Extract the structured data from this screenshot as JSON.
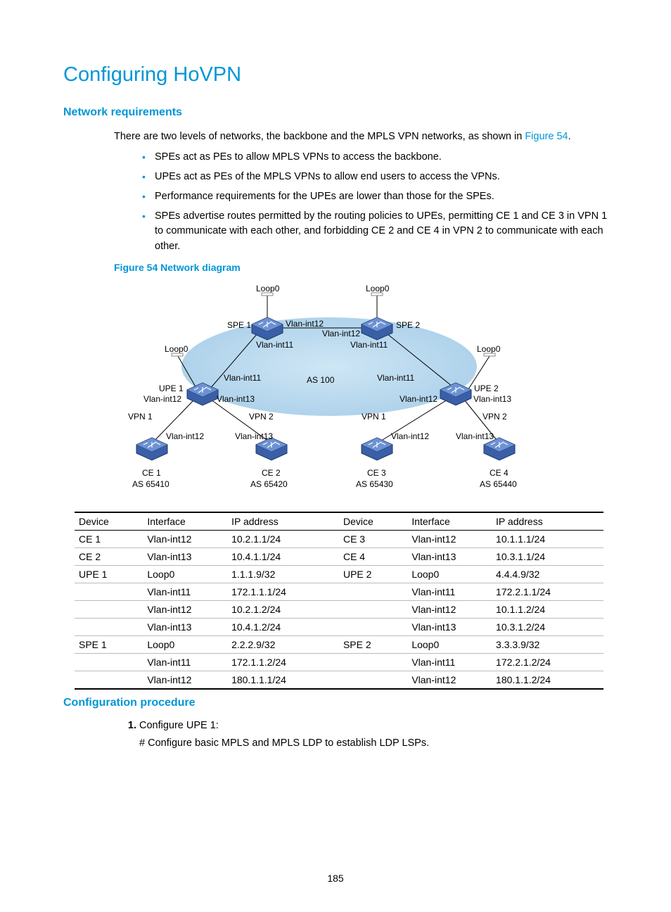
{
  "title": "Configuring HoVPN",
  "sections": {
    "network_req_heading": "Network requirements",
    "intro_pre": "There are two levels of networks, the backbone and the MPLS VPN networks, as shown in ",
    "intro_link": "Figure 54",
    "intro_post": ".",
    "bullets": [
      "SPEs act as PEs to allow MPLS VPNs to access the backbone.",
      "UPEs act as PEs of the MPLS VPNs to allow end users to access the VPNs.",
      "Performance requirements for the UPEs are lower than those for the SPEs.",
      "SPEs advertise routes permitted by the routing policies to UPEs, permitting CE 1 and CE 3 in VPN 1 to communicate with each other, and forbidding CE 2 and CE 4 in VPN 2 to communicate with each other."
    ],
    "figure_caption": "Figure 54 Network diagram",
    "config_proc_heading": "Configuration procedure",
    "step1_title": "Configure UPE 1:",
    "step1_line": "# Configure basic MPLS and MPLS LDP to establish LDP LSPs."
  },
  "diagram": {
    "as_cloud": "AS 100",
    "loop0": "Loop0",
    "spe1": "SPE 1",
    "spe2": "SPE 2",
    "upe1": "UPE 1",
    "upe2": "UPE 2",
    "vpn1": "VPN 1",
    "vpn2": "VPN 2",
    "vlan11": "Vlan-int11",
    "vlan12": "Vlan-int12",
    "vlan13": "Vlan-int13",
    "ce1": "CE 1",
    "ce2": "CE 2",
    "ce3": "CE 3",
    "ce4": "CE 4",
    "as65410": "AS 65410",
    "as65420": "AS 65420",
    "as65430": "AS 65430",
    "as65440": "AS 65440"
  },
  "table": {
    "headers": [
      "Device",
      "Interface",
      "IP address",
      "Device",
      "Interface",
      "IP address"
    ],
    "rows": [
      [
        "CE 1",
        "Vlan-int12",
        "10.2.1.1/24",
        "CE 3",
        "Vlan-int12",
        "10.1.1.1/24"
      ],
      [
        "CE 2",
        "Vlan-int13",
        "10.4.1.1/24",
        "CE 4",
        "Vlan-int13",
        "10.3.1.1/24"
      ],
      [
        "UPE 1",
        "Loop0",
        "1.1.1.9/32",
        "UPE 2",
        "Loop0",
        "4.4.4.9/32"
      ],
      [
        "",
        "Vlan-int11",
        "172.1.1.1/24",
        "",
        "Vlan-int11",
        "172.2.1.1/24"
      ],
      [
        "",
        "Vlan-int12",
        "10.2.1.2/24",
        "",
        "Vlan-int12",
        "10.1.1.2/24"
      ],
      [
        "",
        "Vlan-int13",
        "10.4.1.2/24",
        "",
        "Vlan-int13",
        "10.3.1.2/24"
      ],
      [
        "SPE 1",
        "Loop0",
        "2.2.2.9/32",
        "SPE 2",
        "Loop0",
        "3.3.3.9/32"
      ],
      [
        "",
        "Vlan-int11",
        "172.1.1.2/24",
        "",
        "Vlan-int11",
        "172.2.1.2/24"
      ],
      [
        "",
        "Vlan-int12",
        "180.1.1.1/24",
        "",
        "Vlan-int12",
        "180.1.1.2/24"
      ]
    ]
  },
  "page_number": "185"
}
